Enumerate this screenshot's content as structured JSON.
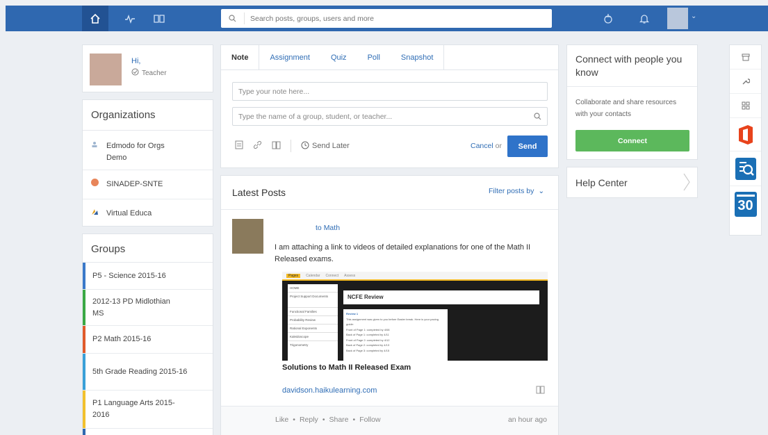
{
  "nav": {
    "search_placeholder": "Search posts, groups, users and more"
  },
  "profile": {
    "greeting": "Hi,",
    "role": "Teacher"
  },
  "organizations": {
    "title": "Organizations",
    "items": [
      {
        "label": "Edmodo for Orgs Demo"
      },
      {
        "label": "SINADEP-SNTE"
      },
      {
        "label": "Virtual Educa"
      }
    ]
  },
  "groups": {
    "title": "Groups",
    "items": [
      {
        "label": "P5 - Science 2015-16",
        "color": "#3a79c9"
      },
      {
        "label": "2012-13 PD Midlothian MS",
        "color": "#3aa845"
      },
      {
        "label": "P2 Math 2015-16",
        "color": "#e05a2b"
      },
      {
        "label": "5th Grade Reading 2015-16",
        "color": "#3aa0d8"
      },
      {
        "label": "P1 Language Arts 2015-2016",
        "color": "#f2c12e"
      }
    ]
  },
  "composer": {
    "tabs": [
      "Note",
      "Assignment",
      "Quiz",
      "Poll",
      "Snapshot"
    ],
    "note_placeholder": "Type your note here...",
    "recipient_placeholder": "Type the name of a group, student, or teacher...",
    "send_later": "Send Later",
    "cancel": "Cancel",
    "or": "or",
    "send": "Send"
  },
  "feed": {
    "title": "Latest Posts",
    "filter": "Filter posts by",
    "post": {
      "to": "to",
      "group": "Math",
      "body": "I am attaching a link to videos of detailed explanations for one of the Math II Released exams.",
      "link_title": "Solutions to Math II Released Exam",
      "link_url": "davidson.haikulearning.com",
      "actions": [
        "Like",
        "Reply",
        "Share",
        "Follow"
      ],
      "time": "an hour ago",
      "preview": {
        "tabs": [
          "Pages",
          "Calendar",
          "Connect",
          "Assess"
        ],
        "sidebar": [
          "HOME",
          "Project Support Documents",
          "Functional Families",
          "Probability Review",
          "Rational Exponents",
          "Kaleidoscope",
          "Trigonometry"
        ],
        "heading": "NCFE Review",
        "sub": "Review 1",
        "lines": [
          "This assignment was given to you before Easter break. Here is your pacing guide:",
          "Front of Page 1: completed by 4/08",
          "Back of Page 1: completed by 4/11",
          "Front of Page 2: completed by 4/12",
          "Back of Page 2: completed by 4/13",
          "Back of Page 3: completed by 4/15"
        ]
      }
    }
  },
  "connect": {
    "title": "Connect with people you know",
    "text": "Collaborate and share resources with your contacts",
    "button": "Connect",
    "button_color": "#5cb85c"
  },
  "help": {
    "label": "Help Center"
  },
  "rail": {
    "calendar_day": "30"
  }
}
